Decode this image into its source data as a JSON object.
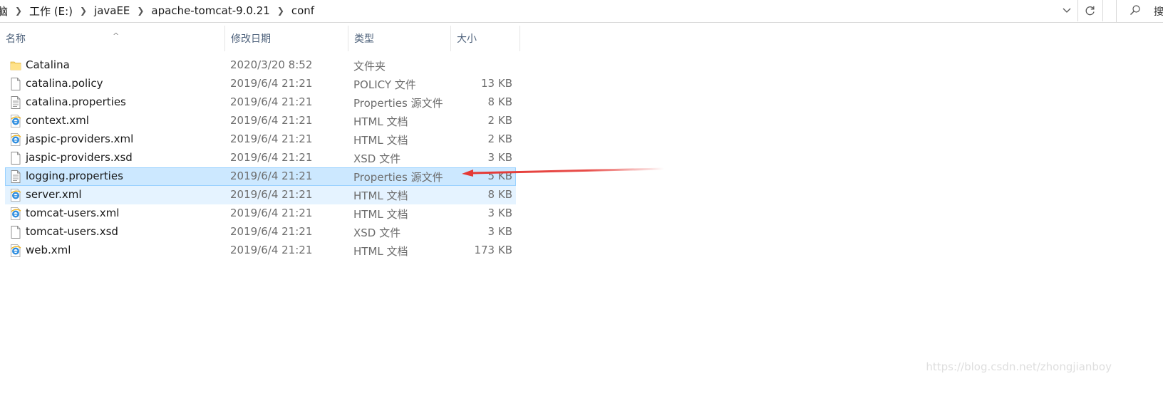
{
  "breadcrumb": {
    "items": [
      {
        "label": "脑"
      },
      {
        "label": "工作 (E:)"
      },
      {
        "label": "javaEE"
      },
      {
        "label": "apache-tomcat-9.0.21"
      },
      {
        "label": "conf"
      }
    ]
  },
  "address_bar": {
    "dropdown_icon": "chevron-down-icon",
    "refresh_icon": "refresh-icon"
  },
  "search": {
    "icon": "search-icon",
    "placeholder": "搜"
  },
  "columns": {
    "name": "名称",
    "date": "修改日期",
    "type": "类型",
    "size": "大小",
    "sort_indicator": "^"
  },
  "files": [
    {
      "name": "Catalina",
      "date": "2020/3/20 8:52",
      "type": "文件夹",
      "size": "",
      "icon": "folder-icon",
      "state": "normal"
    },
    {
      "name": "catalina.policy",
      "date": "2019/6/4 21:21",
      "type": "POLICY 文件",
      "size": "13 KB",
      "icon": "blank-file-icon",
      "state": "normal"
    },
    {
      "name": "catalina.properties",
      "date": "2019/6/4 21:21",
      "type": "Properties 源文件",
      "size": "8 KB",
      "icon": "text-file-icon",
      "state": "normal"
    },
    {
      "name": "context.xml",
      "date": "2019/6/4 21:21",
      "type": "HTML 文档",
      "size": "2 KB",
      "icon": "ie-html-icon",
      "state": "normal"
    },
    {
      "name": "jaspic-providers.xml",
      "date": "2019/6/4 21:21",
      "type": "HTML 文档",
      "size": "2 KB",
      "icon": "ie-html-icon",
      "state": "normal"
    },
    {
      "name": "jaspic-providers.xsd",
      "date": "2019/6/4 21:21",
      "type": "XSD 文件",
      "size": "3 KB",
      "icon": "blank-file-icon",
      "state": "normal"
    },
    {
      "name": "logging.properties",
      "date": "2019/6/4 21:21",
      "type": "Properties 源文件",
      "size": "5 KB",
      "icon": "text-file-icon",
      "state": "selected"
    },
    {
      "name": "server.xml",
      "date": "2019/6/4 21:21",
      "type": "HTML 文档",
      "size": "8 KB",
      "icon": "ie-html-icon",
      "state": "hovered"
    },
    {
      "name": "tomcat-users.xml",
      "date": "2019/6/4 21:21",
      "type": "HTML 文档",
      "size": "3 KB",
      "icon": "ie-html-icon",
      "state": "normal"
    },
    {
      "name": "tomcat-users.xsd",
      "date": "2019/6/4 21:21",
      "type": "XSD 文件",
      "size": "3 KB",
      "icon": "blank-file-icon",
      "state": "normal"
    },
    {
      "name": "web.xml",
      "date": "2019/6/4 21:21",
      "type": "HTML 文档",
      "size": "173 KB",
      "icon": "ie-html-icon",
      "state": "normal"
    }
  ],
  "annotation": {
    "icon": "red-arrow-icon",
    "color": "#e53935"
  },
  "watermark": "https://blog.csdn.net/zhongjianboy",
  "colors": {
    "selected_bg": "#cce8ff",
    "selected_border": "#99d1ff",
    "hover_bg": "#e5f3ff",
    "header_text": "#4c607a",
    "secondary_text": "#6d6d6d"
  }
}
